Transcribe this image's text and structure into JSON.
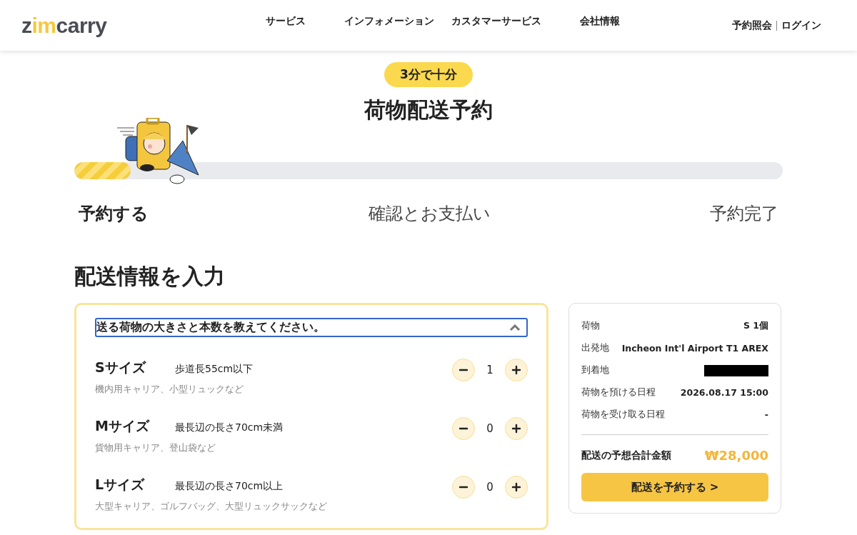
{
  "header": {
    "logo": [
      {
        "text": "z",
        "accent": false
      },
      {
        "text": "im",
        "accent": true
      },
      {
        "text": "carry",
        "accent": false
      }
    ],
    "nav": [
      "サービス",
      "インフォメーション",
      "カスタマーサービス",
      "会社情報"
    ],
    "links": [
      "予約照会",
      "ログイン"
    ]
  },
  "hero": {
    "badge": "3分で十分",
    "title": "荷物配送予約"
  },
  "progress": {
    "level": 0.08
  },
  "steps": [
    {
      "label": "予約する",
      "selected": true
    },
    {
      "label": "確認とお支払い",
      "selected": false
    },
    {
      "label": "予約完了",
      "selected": false
    }
  ],
  "section_title": "配送情報を入力",
  "size_panel": {
    "question": "送る荷物の大きさと本数を教えてください。",
    "expanded": true,
    "sizes": [
      {
        "name": "Sサイズ",
        "spec": "歩道長55cm以下",
        "examples": "機内用キャリア、小型リュックなど",
        "count": "1"
      },
      {
        "name": "Mサイズ",
        "spec": "最長辺の長さ70cm未満",
        "examples": "貨物用キャリア、登山袋など",
        "count": "0"
      },
      {
        "name": "Lサイズ",
        "spec": "最長辺の長さ70cm以上",
        "examples": "大型キャリア、ゴルフバッグ、大型リュックサックなど",
        "count": "0"
      }
    ]
  },
  "summary": {
    "rows": [
      {
        "label": "荷物",
        "value": "S 1個",
        "redacted": false
      },
      {
        "label": "出発地",
        "value": "Incheon Int'l Airport T1 AREX",
        "redacted": false
      },
      {
        "label": "到着地",
        "redacted": true
      },
      {
        "label": "荷物を預ける日程",
        "value": "2026.08.17 15:00",
        "redacted": false
      },
      {
        "label": "荷物を受け取る日程",
        "value": "-",
        "redacted": false
      }
    ],
    "total_label": "配送の予想合計金額",
    "total": "₩28,000",
    "button": "配送を予約する >"
  }
}
